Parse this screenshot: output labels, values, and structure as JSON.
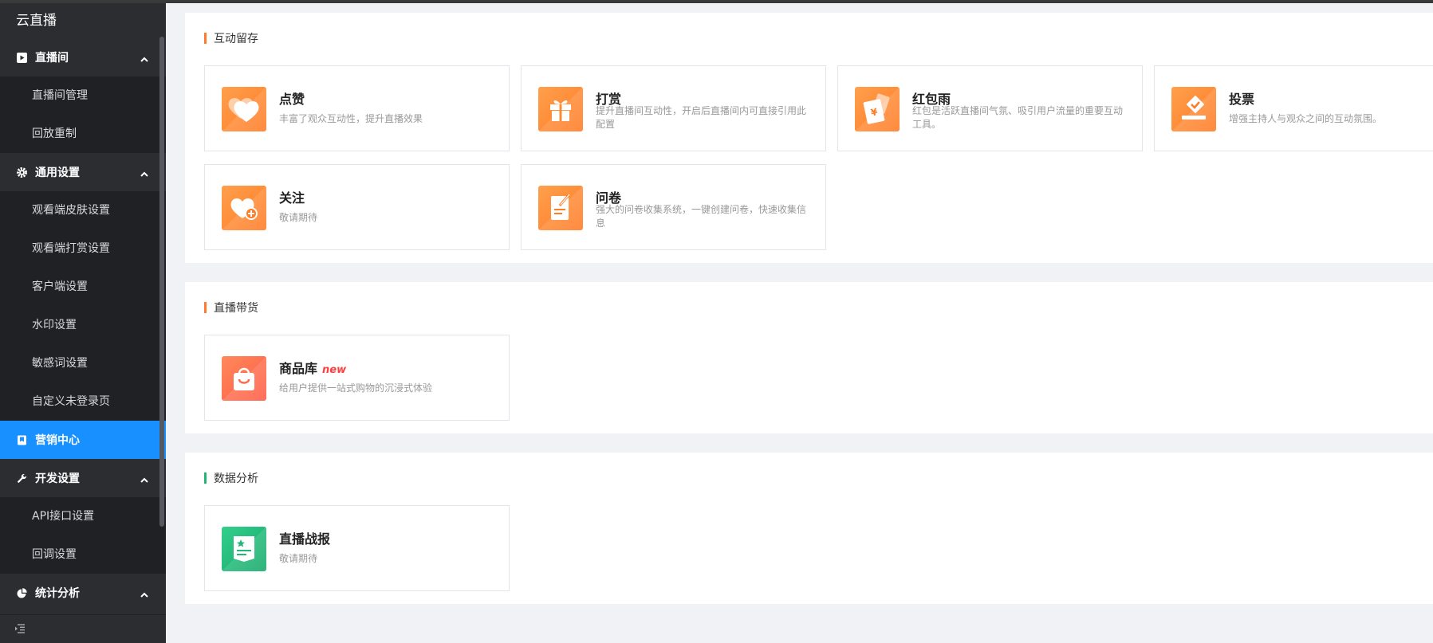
{
  "sidebar": {
    "brand": "云直播",
    "groups": [
      {
        "label": "直播间",
        "items": [
          "直播间管理",
          "回放重制"
        ]
      },
      {
        "label": "通用设置",
        "items": [
          "观看端皮肤设置",
          "观看端打赏设置",
          "客户端设置",
          "水印设置",
          "敏感词设置",
          "自定义未登录页"
        ]
      },
      {
        "label": "营销中心",
        "items": []
      },
      {
        "label": "开发设置",
        "items": [
          "API接口设置",
          "回调设置"
        ]
      },
      {
        "label": "统计分析",
        "items": []
      }
    ]
  },
  "sections": [
    {
      "title": "互动留存",
      "cards": [
        {
          "title": "点赞",
          "desc": "丰富了观众互动性，提升直播效果",
          "icon": "heart-icon"
        },
        {
          "title": "打赏",
          "desc": "提升直播间互动性，开启后直播间内可直接引用此配置",
          "icon": "gift-icon"
        },
        {
          "title": "红包雨",
          "desc": "红包是活跃直播间气氛、吸引用户流量的重要互动工具。",
          "icon": "red-packet-icon"
        },
        {
          "title": "投票",
          "desc": "增强主持人与观众之间的互动氛围。",
          "icon": "vote-icon"
        },
        {
          "title": "关注",
          "desc": "敬请期待",
          "icon": "follow-heart-icon"
        },
        {
          "title": "问卷",
          "desc": "强大的问卷收集系统，一键创建问卷，快速收集信息",
          "icon": "questionnaire-icon"
        }
      ]
    },
    {
      "title": "直播带货",
      "cards": [
        {
          "title": "商品库",
          "badge": "new",
          "desc": "给用户提供一站式购物的沉浸式体验",
          "icon": "shopping-bag-icon"
        }
      ]
    },
    {
      "title": "数据分析",
      "cards": [
        {
          "title": "直播战报",
          "desc": "敬请期待",
          "icon": "report-icon"
        }
      ]
    }
  ],
  "colors": {
    "accent_orange": "#ff7a2e",
    "accent_green": "#22b573",
    "active_blue": "#1890ff",
    "sidebar_bg": "#2b2d31"
  }
}
